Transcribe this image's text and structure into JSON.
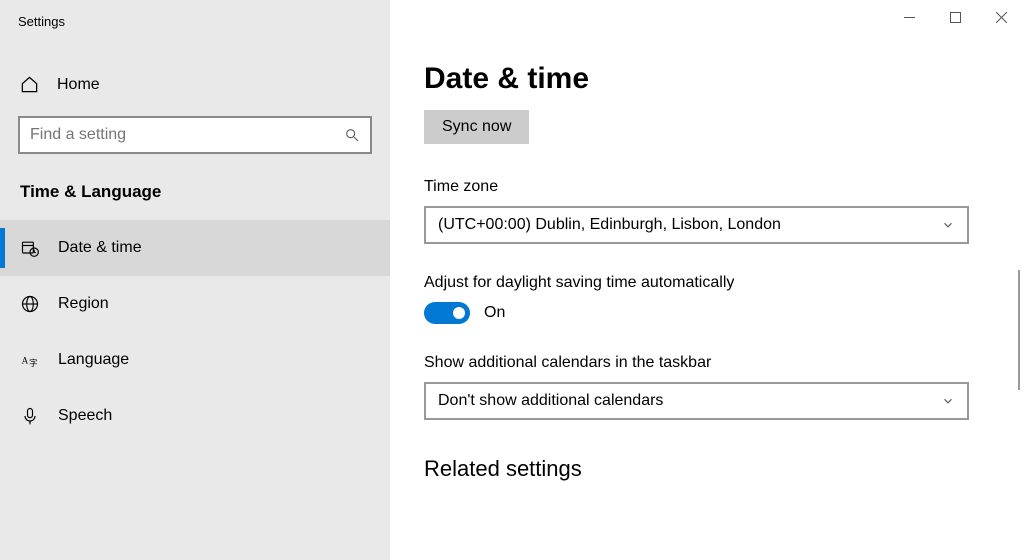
{
  "window": {
    "title": "Settings"
  },
  "sidebar": {
    "home_label": "Home",
    "search_placeholder": "Find a setting",
    "category": "Time & Language",
    "items": [
      {
        "label": "Date & time"
      },
      {
        "label": "Region"
      },
      {
        "label": "Language"
      },
      {
        "label": "Speech"
      }
    ]
  },
  "page": {
    "title": "Date & time",
    "sync_button": "Sync now",
    "timezone_label": "Time zone",
    "timezone_value": "(UTC+00:00) Dublin, Edinburgh, Lisbon, London",
    "dst_label": "Adjust for daylight saving time automatically",
    "dst_state": "On",
    "calendars_label": "Show additional calendars in the taskbar",
    "calendars_value": "Don't show additional calendars",
    "related_heading": "Related settings"
  }
}
